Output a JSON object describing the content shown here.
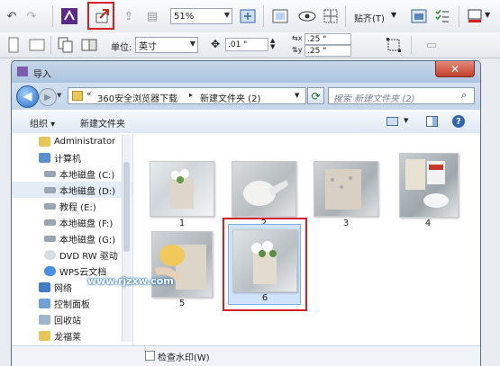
{
  "app_toolbar": {
    "zoom": "51%",
    "paste_label": "贴齐(T)",
    "units_label": "单位:",
    "units_value": "英寸",
    "nudge_value": ".01 \"",
    "dup_x": ".25 \"",
    "dup_y": ".25 \""
  },
  "dialog": {
    "title": "导入",
    "close_glyph": "✕",
    "breadcrumb": [
      "360安全浏览器下载",
      "新建文件夹 (2)"
    ],
    "search_placeholder": "搜索 新建文件夹 (2)",
    "organize_label": "组织 ▾",
    "new_folder_label": "新建文件夹",
    "help_glyph": "?"
  },
  "nav_tree": [
    {
      "label": "Administrator",
      "icon": "user-folder-icon"
    },
    {
      "label": "计算机",
      "icon": "computer-icon"
    },
    {
      "label": "本地磁盘 (C:)",
      "icon": "drive-icon"
    },
    {
      "label": "本地磁盘 (D:)",
      "icon": "drive-icon"
    },
    {
      "label": "教程 (E:)",
      "icon": "drive-icon"
    },
    {
      "label": "本地磁盘 (F:)",
      "icon": "drive-icon"
    },
    {
      "label": "本地磁盘 (G:)",
      "icon": "drive-icon"
    },
    {
      "label": "DVD RW 驱动",
      "icon": "dvd-icon"
    },
    {
      "label": "WPS云文档",
      "icon": "cloud-icon"
    },
    {
      "label": "网络",
      "icon": "network-icon"
    },
    {
      "label": "控制面板",
      "icon": "control-panel-icon"
    },
    {
      "label": "回收站",
      "icon": "recycle-bin-icon"
    },
    {
      "label": "龙福莱",
      "icon": "folder-icon"
    }
  ],
  "files": [
    {
      "name": "1"
    },
    {
      "name": "2"
    },
    {
      "name": "3"
    },
    {
      "name": "4"
    },
    {
      "name": "5"
    },
    {
      "name": "6"
    }
  ],
  "watermark": "www.rjzxw.com",
  "footer": {
    "checkbox_label": "检查水印(W)"
  },
  "colors": {
    "highlight_red": "#d62020",
    "selection_blue": "#cfe3fb"
  }
}
